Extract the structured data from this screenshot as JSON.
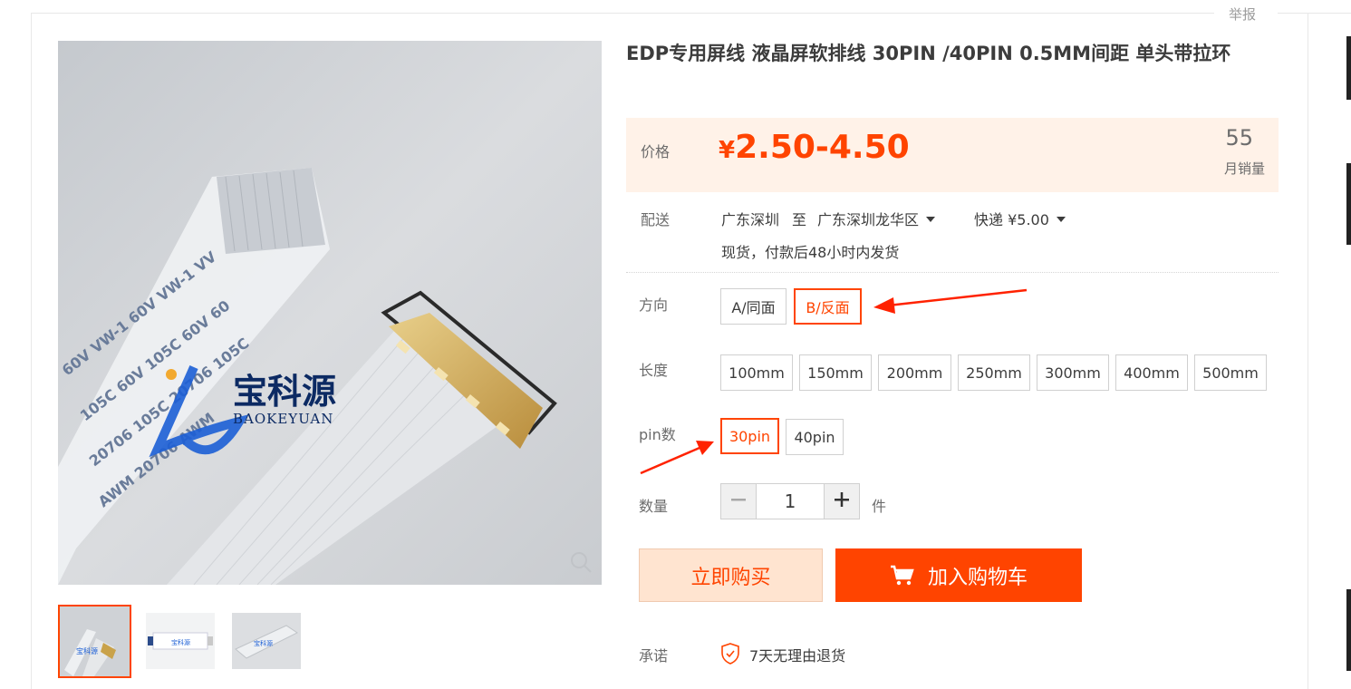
{
  "page": {
    "report_link": "举报",
    "title": "EDP专用屏线 液晶屏软排线 30PIN /40PIN 0.5MM间距 单头带拉环",
    "gallery": {
      "brand_cn": "宝科源",
      "brand_en": "BAOKEYUAN"
    }
  },
  "price": {
    "label": "价格",
    "symbol": "¥",
    "range": "2.50-4.50",
    "monthly_sales": "55",
    "monthly_sales_label": "月销量"
  },
  "delivery": {
    "label": "配送",
    "from": "广东深圳",
    "to_word": "至",
    "to": "广东深圳龙华区",
    "shipping": "快递 ¥5.00",
    "stock_note": "现货，付款后48小时内发货"
  },
  "direction": {
    "label": "方向",
    "options": [
      "A/同面",
      "B/反面"
    ],
    "selected": "B/反面"
  },
  "length": {
    "label": "长度",
    "options": [
      "100mm",
      "150mm",
      "200mm",
      "250mm",
      "300mm",
      "400mm",
      "500mm"
    ]
  },
  "pins": {
    "label": "pin数",
    "options": [
      "30pin",
      "40pin"
    ],
    "selected": "30pin"
  },
  "quantity": {
    "label": "数量",
    "minus": "−",
    "value": "1",
    "plus": "+",
    "unit": "件"
  },
  "actions": {
    "buy_now": "立即购买",
    "add_to_cart": "加入购物车"
  },
  "promise": {
    "label": "承诺",
    "text": "7天无理由退货"
  },
  "colors": {
    "accent": "#ff4400",
    "price_bg": "#fff2e8",
    "buy_bg": "#ffe4d0",
    "annotation_arrow": "#ff2200"
  },
  "icons": [
    "zoom-icon",
    "cart-icon",
    "shield-check-icon",
    "chevron-down-icon",
    "minus-icon",
    "plus-icon"
  ]
}
